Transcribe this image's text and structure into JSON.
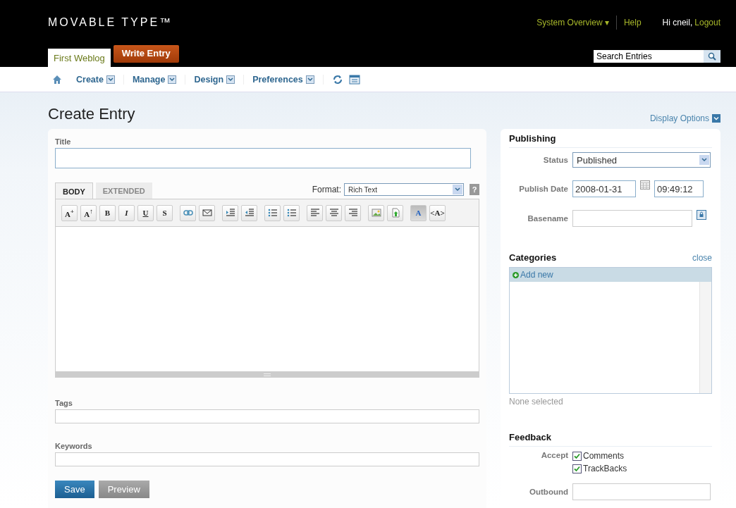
{
  "header": {
    "logo": "MOVABLE TYPE™",
    "system_menu": "System Overview ▾",
    "help": "Help",
    "greeting": "Hi cneil,",
    "logout": "Logout",
    "tabs": [
      {
        "label": "First Weblog",
        "kind": "blog",
        "selected": true
      },
      {
        "label": "Write Entry",
        "kind": "action",
        "selected": false
      }
    ],
    "search": {
      "placeholder": "Search Entries"
    }
  },
  "nav": {
    "items": [
      {
        "label": "Create"
      },
      {
        "label": "Manage"
      },
      {
        "label": "Design"
      },
      {
        "label": "Preferences"
      }
    ]
  },
  "page_title": "Create Entry",
  "display_options": "Display Options",
  "entry": {
    "title_label": "Title",
    "editor_tabs": [
      {
        "label": "BODY",
        "selected": true
      },
      {
        "label": "EXTENDED",
        "selected": false
      }
    ],
    "format_label": "Format:",
    "format_value": "Rich Text",
    "help": "?",
    "toolbar": [
      {
        "kind": "text",
        "label": "A",
        "sup": "+",
        "selected": false
      },
      {
        "kind": "text",
        "label": "A",
        "sup": "↑",
        "selected": false
      },
      {
        "kind": "text",
        "label": "B",
        "selected": false
      },
      {
        "kind": "text",
        "label": "I",
        "selected": false
      },
      {
        "kind": "text",
        "label": "U",
        "selected": false
      },
      {
        "kind": "text",
        "label": "S",
        "selected": false
      },
      {
        "kind": "link",
        "selected": false
      },
      {
        "kind": "email",
        "selected": false
      },
      {
        "kind": "indent",
        "selected": false
      },
      {
        "kind": "outdent",
        "selected": false
      },
      {
        "kind": "bullets",
        "selected": false
      },
      {
        "kind": "numbers",
        "selected": false
      },
      {
        "kind": "left",
        "selected": false
      },
      {
        "kind": "center",
        "selected": false
      },
      {
        "kind": "right",
        "selected": false
      },
      {
        "kind": "image",
        "selected": false
      },
      {
        "kind": "file",
        "selected": false
      },
      {
        "kind": "text",
        "label": "A",
        "selected": true
      },
      {
        "kind": "text",
        "label": "<A>",
        "selected": false
      }
    ],
    "tags_label": "Tags",
    "keywords_label": "Keywords",
    "buttons": [
      {
        "label": "Save",
        "kind": "primary"
      },
      {
        "label": "Preview",
        "kind": "secondary"
      }
    ]
  },
  "publishing": {
    "heading": "Publishing",
    "status_label": "Status",
    "status_value": "Published",
    "date_label": "Publish Date",
    "date_value": "2008-01-31",
    "time_value": "09:49:12",
    "basename_label": "Basename"
  },
  "categories": {
    "heading": "Categories",
    "close": "close",
    "add_new": "Add new",
    "summary": "None selected"
  },
  "feedback": {
    "heading": "Feedback",
    "accept_label": "Accept",
    "options": [
      {
        "label": "Comments",
        "checked": true
      },
      {
        "label": "TrackBacks",
        "checked": true
      }
    ],
    "outbound_label": "Outbound"
  }
}
